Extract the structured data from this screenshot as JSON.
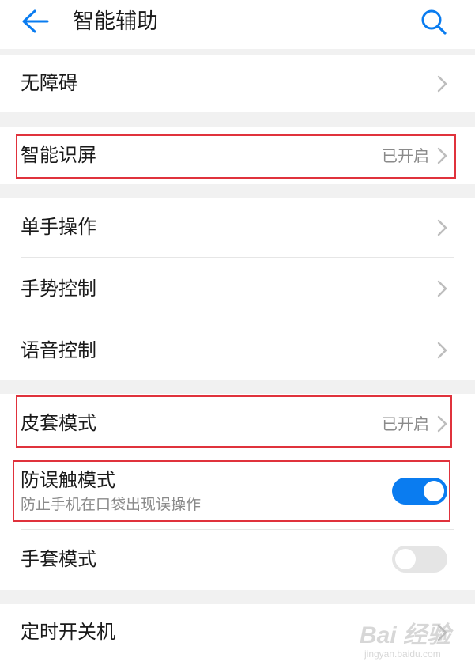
{
  "header": {
    "title": "智能辅助",
    "back_icon": "arrow-left-icon",
    "search_icon": "search-icon",
    "accent_color": "#0a7cf0"
  },
  "items": [
    {
      "label": "无障碍"
    },
    {
      "label": "智能识屏",
      "status": "已开启"
    },
    {
      "label": "单手操作"
    },
    {
      "label": "手势控制"
    },
    {
      "label": "语音控制"
    },
    {
      "label": "皮套模式",
      "status": "已开启"
    },
    {
      "label": "防误触模式",
      "sub": "防止手机在口袋出现误操作",
      "toggle": "on"
    },
    {
      "label": "手套模式",
      "toggle": "off"
    },
    {
      "label": "定时开关机"
    }
  ],
  "watermark": {
    "main": "Bai 经验",
    "sub": "jingyan.baidu.com"
  }
}
